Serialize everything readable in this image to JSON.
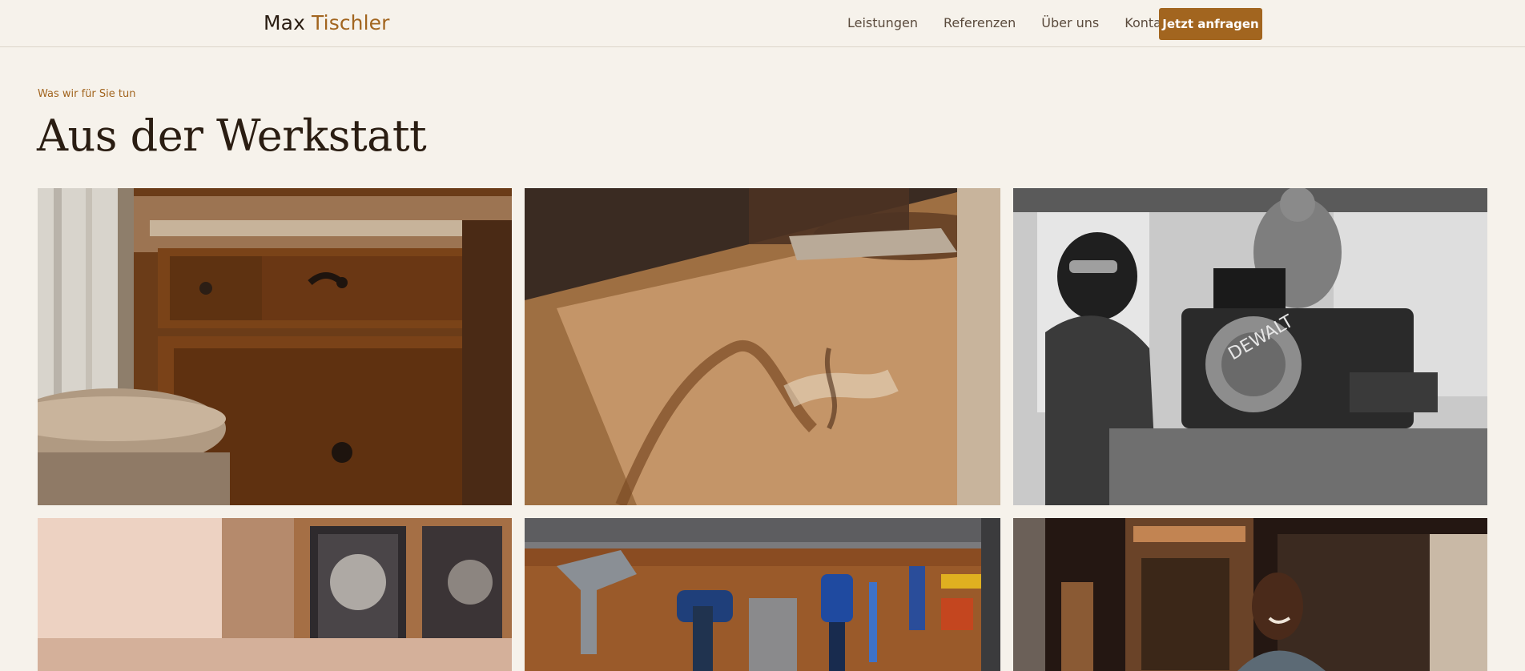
{
  "header": {
    "brand_first": "Max",
    "brand_second": "Tischler",
    "nav": [
      "Leistungen",
      "Referenzen",
      "Über uns",
      "Kontakt"
    ],
    "cta_label": "Jetzt anfragen"
  },
  "section": {
    "eyebrow": "Was wir für Sie tun",
    "title": "Aus der Werkstatt"
  },
  "gallery": [
    {
      "subject": "antique wooden dresser with metal handles"
    },
    {
      "subject": "hand oiling a wooden board"
    },
    {
      "subject": "boy using a miter saw in black and white"
    },
    {
      "subject": "blurred window frame"
    },
    {
      "subject": "power tools hanging on a wooden wall"
    },
    {
      "subject": "smiling man in a carpentry workshop"
    }
  ],
  "colors": {
    "background": "#f6f2eb",
    "accent": "#a2651f",
    "text": "#2a1d12"
  }
}
